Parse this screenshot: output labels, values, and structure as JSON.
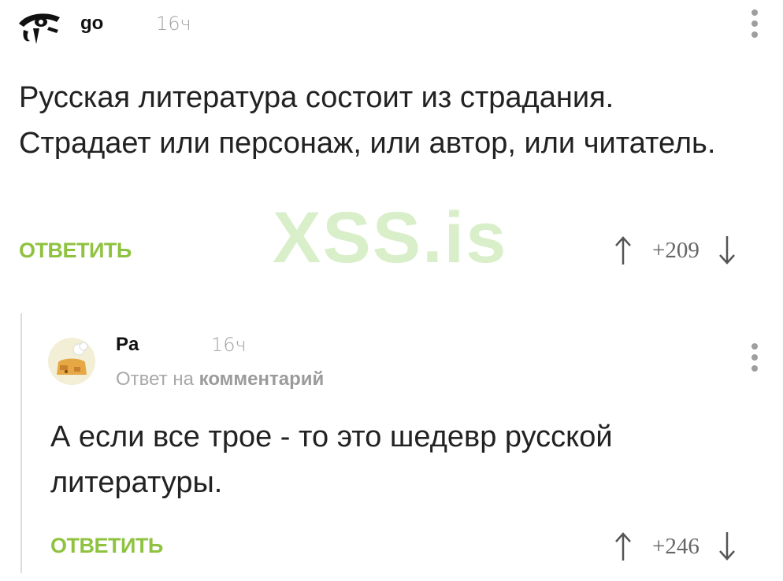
{
  "comments": [
    {
      "user": "go",
      "time": "16ч",
      "text": "Русская литература состоит из страдания. Страдает или персонаж, или автор, или читатель.",
      "reply_label": "ОТВЕТИТЬ",
      "score": "+209",
      "avatar_icon": "eye-of-horus-icon"
    },
    {
      "user": "Pa",
      "time": "16ч",
      "reply_to_prefix": "Ответ на",
      "reply_to_target": "комментарий",
      "text": "А если все трое - то это шедевр русской литературы.",
      "reply_label": "ОТВЕТИТЬ",
      "score": "+246",
      "avatar_icon": "cartoon-avatar-icon"
    }
  ],
  "watermark": "XSS.is",
  "colors": {
    "accent": "#8fc240",
    "muted": "#a2a2a2",
    "text": "#222222",
    "watermark": "#d9efca"
  }
}
